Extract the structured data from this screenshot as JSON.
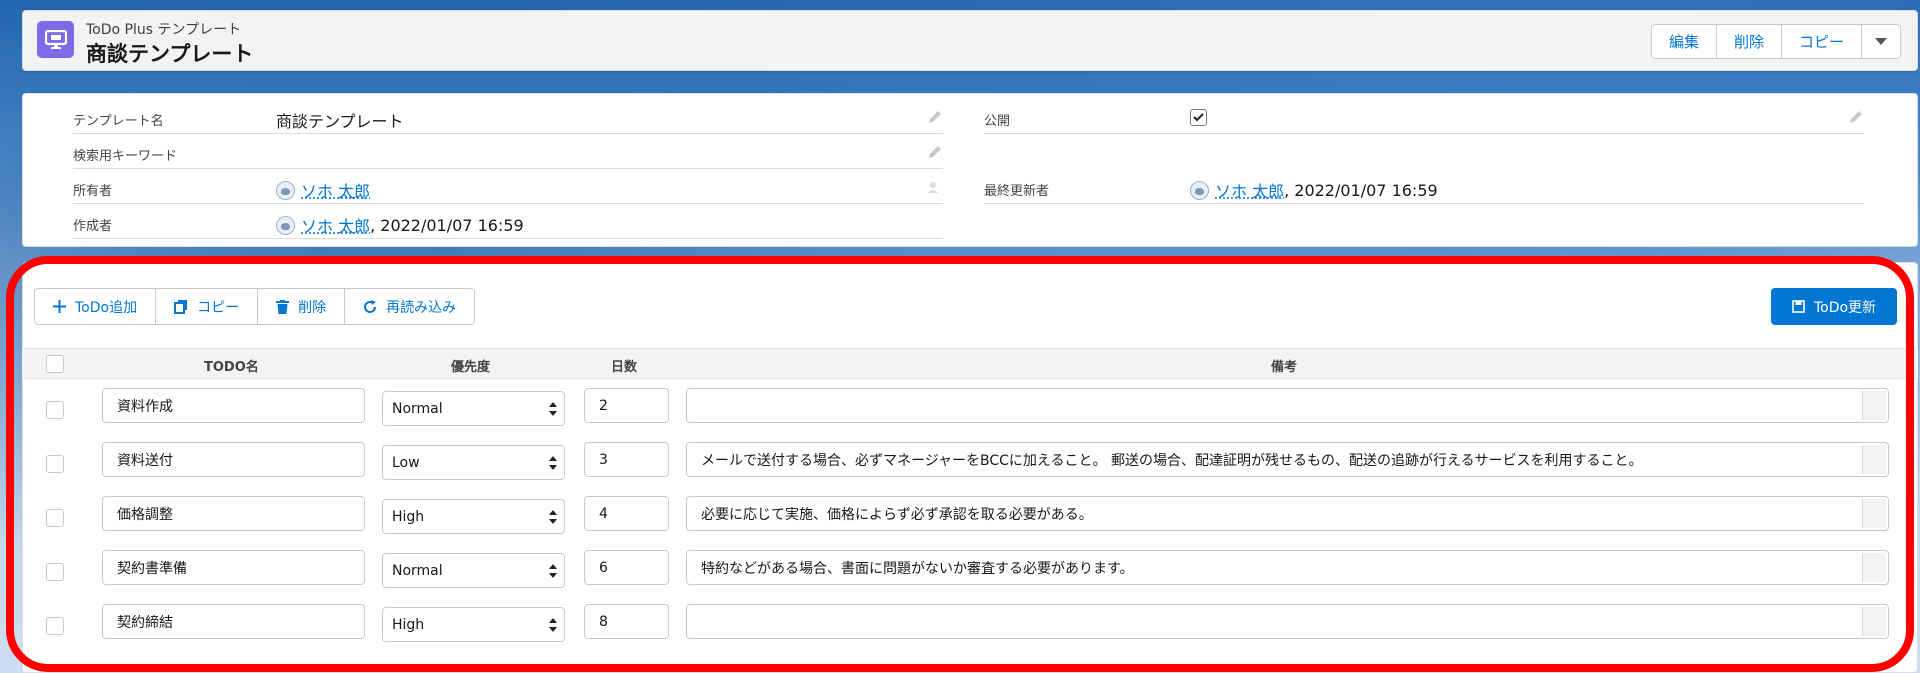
{
  "header": {
    "object_label": "ToDo Plus テンプレート",
    "record_title": "商談テンプレート",
    "actions": [
      "編集",
      "削除",
      "コピー"
    ]
  },
  "details": {
    "template_name_label": "テンプレート名",
    "template_name_value": "商談テンプレート",
    "keyword_label": "検索用キーワード",
    "owner_label": "所有者",
    "owner_value": "ソホ 太郎",
    "creator_label": "作成者",
    "creator_value": "ソホ 太郎",
    "creator_date": ", 2022/01/07 16:59",
    "public_label": "公開",
    "public_checked": true,
    "modifier_label": "最終更新者",
    "modifier_value": "ソホ 太郎",
    "modifier_date": ", 2022/01/07 16:59"
  },
  "toolbar": {
    "add": "ToDo追加",
    "copy": "コピー",
    "delete": "削除",
    "reload": "再読み込み",
    "update": "ToDo更新"
  },
  "table": {
    "headers": [
      "TODO名",
      "優先度",
      "日数",
      "備考"
    ],
    "rows": [
      {
        "name": "資料作成",
        "priority": "Normal",
        "days": "2",
        "note": ""
      },
      {
        "name": "資料送付",
        "priority": "Low",
        "days": "3",
        "note": "メールで送付する場合、必ずマネージャーをBCCに加えること。 郵送の場合、配達証明が残せるもの、配送の追跡が行えるサービスを利用すること。"
      },
      {
        "name": "価格調整",
        "priority": "High",
        "days": "4",
        "note": "必要に応じて実施、価格によらず必ず承認を取る必要がある。"
      },
      {
        "name": "契約書準備",
        "priority": "Normal",
        "days": "6",
        "note": "特約などがある場合、書面に問題がないか審査する必要があります。"
      },
      {
        "name": "契約締結",
        "priority": "High",
        "days": "8",
        "note": ""
      }
    ]
  },
  "colors": {
    "brand": "#0176d3",
    "object_icon": "#7f6be8",
    "highlight": "#ff0000"
  }
}
